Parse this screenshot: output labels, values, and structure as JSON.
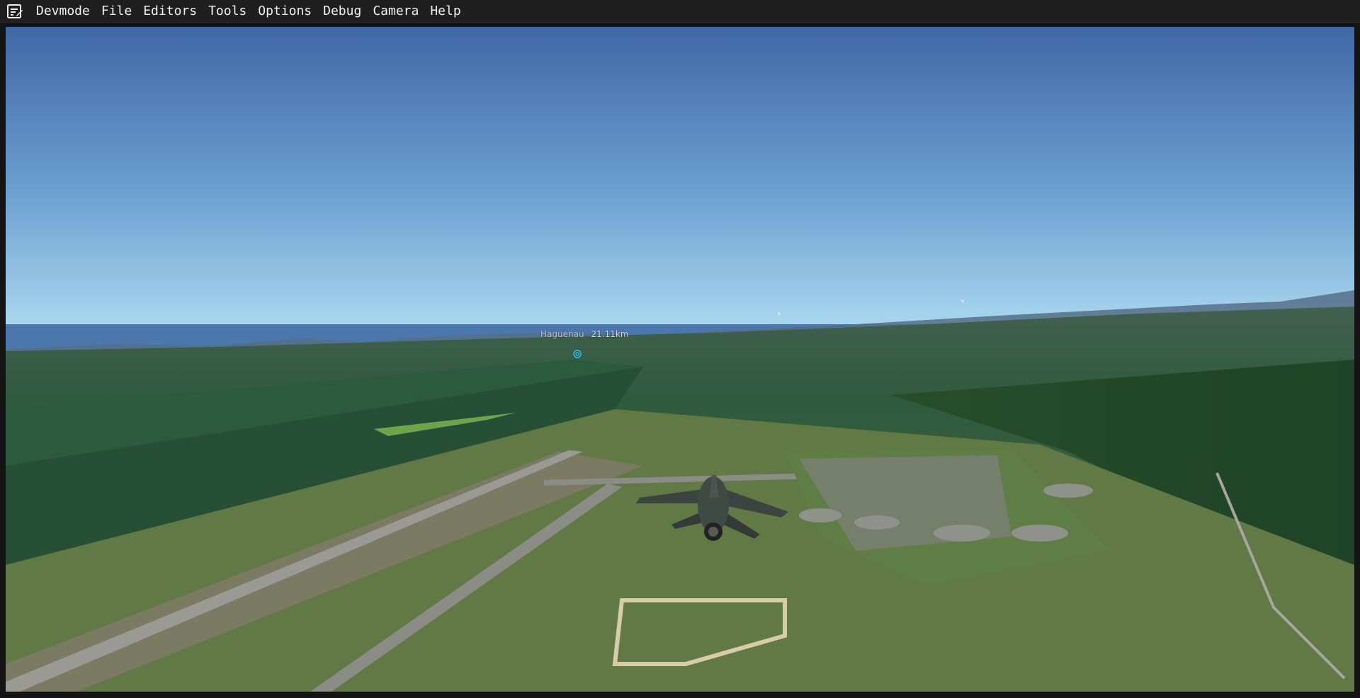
{
  "menubar": {
    "icon": "devmode-notepad-icon",
    "items": [
      {
        "label": "Devmode"
      },
      {
        "label": "File"
      },
      {
        "label": "Editors"
      },
      {
        "label": "Tools"
      },
      {
        "label": "Options"
      },
      {
        "label": "Debug"
      },
      {
        "label": "Camera"
      },
      {
        "label": "Help"
      }
    ]
  },
  "viewport": {
    "scene": "aerial view of military airfield with jet aircraft",
    "poi": {
      "name": "Haguenau",
      "distance": "21.11km",
      "icon": "poi-target-icon"
    }
  },
  "colors": {
    "menubar_bg": "#1f1f1f",
    "sky_top": "#3f68a4",
    "sky_horizon": "#a7d6ee",
    "ground": "#2f5a3e"
  }
}
